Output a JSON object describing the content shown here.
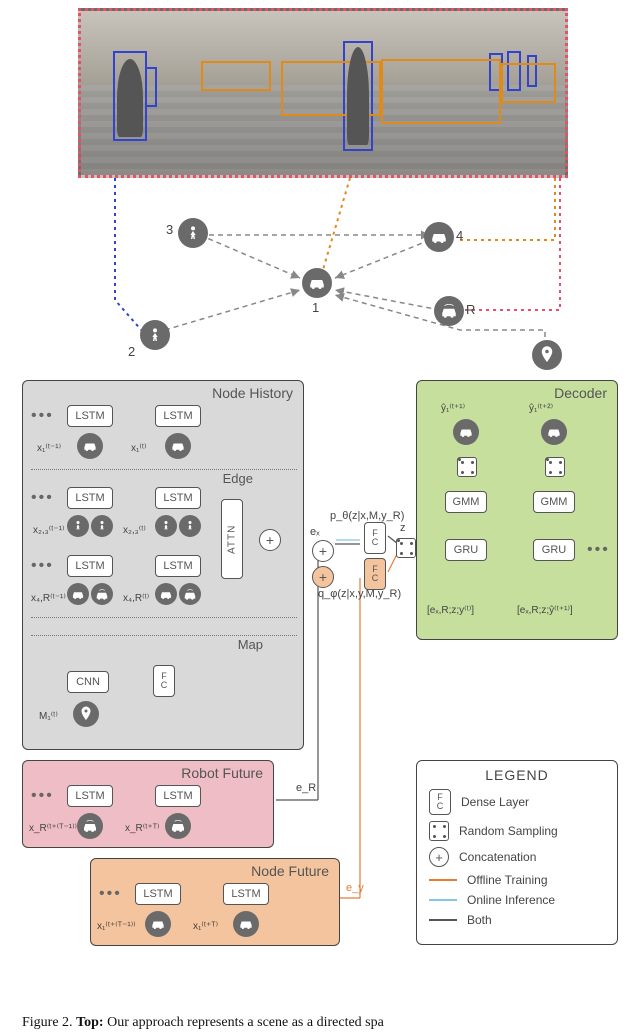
{
  "graph": {
    "nodes": {
      "center": "1",
      "left_up": "3",
      "left_down": "2",
      "right_up": "4",
      "right_mid": "R"
    }
  },
  "encoder": {
    "title": "Node History",
    "edge_title": "Edge",
    "map_title": "Map",
    "lstm": "LSTM",
    "cnn": "CNN",
    "fc": "FC",
    "attn": "ATTN",
    "x_car_prev": "x₁⁽ᵗ⁻¹⁾",
    "x_car_curr": "x₁⁽ᵗ⁾",
    "x_ped_prev": "x₂,₃⁽ᵗ⁻¹⁾",
    "x_ped_curr": "x₂,₃⁽ᵗ⁾",
    "x_carR_prev": "x₄,R⁽ᵗ⁻¹⁾",
    "x_carR_curr": "x₄,R⁽ᵗ⁾",
    "M_label": "M₁⁽ᵗ⁾"
  },
  "latent": {
    "ex": "eₓ",
    "p_label": "p_θ(z|x,M,y_R)",
    "q_label": "q_φ(z|x,y,M,y_R)",
    "z": "z",
    "fc": "FC"
  },
  "robot_future": {
    "title": "Robot Future",
    "lstm": "LSTM",
    "x_prev": "x_R⁽ᵗ⁺⁽ᵀ⁻¹⁾⁾",
    "x_curr": "x_R⁽ᵗ⁺ᵀ⁾",
    "eR": "e_R"
  },
  "node_future": {
    "title": "Node Future",
    "lstm": "LSTM",
    "x_prev": "x₁⁽ᵗ⁺⁽ᵀ⁻¹⁾⁾",
    "x_curr": "x₁⁽ᵗ⁺ᵀ⁾",
    "ey": "e_y"
  },
  "decoder": {
    "title": "Decoder",
    "gru": "GRU",
    "gmm": "GMM",
    "y1": "ŷ₁⁽ᵗ⁺¹⁾",
    "y2": "ŷ₁⁽ᵗ⁺²⁾",
    "in1": "[eₓ,R;z;y⁽ᵗ⁾]",
    "in2": "[eₓ,R;z;ŷ⁽ᵗ⁺¹⁾]"
  },
  "legend": {
    "title": "LEGEND",
    "fc_label": "FC",
    "dense": "Dense Layer",
    "rand": "Random Sampling",
    "concat": "Concatenation",
    "offline": "Offline Training",
    "online": "Online Inference",
    "both": "Both"
  },
  "caption_prefix": "Figure 2. ",
  "caption_bold": "Top:",
  "caption_rest": " Our approach represents a scene as a directed spa"
}
